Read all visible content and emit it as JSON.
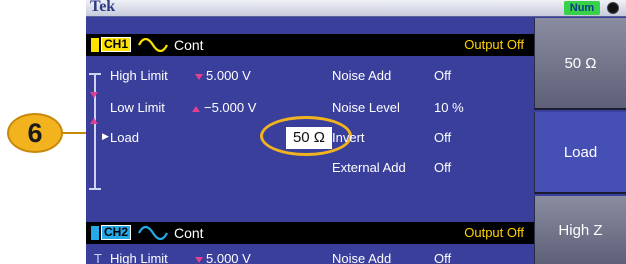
{
  "callout": {
    "number": "6"
  },
  "top_bar": {
    "brand": "Tek",
    "num_badge": "Num"
  },
  "ch1": {
    "label": "CH1",
    "mode": "Cont",
    "output_status": "Output Off",
    "high_limit_label": "High Limit",
    "high_limit_value": "5.000 V",
    "low_limit_label": "Low Limit",
    "low_limit_value": "−5.000 V",
    "load_label": "Load",
    "load_value": "50 Ω",
    "noise_add_label": "Noise Add",
    "noise_add_value": "Off",
    "noise_level_label": "Noise Level",
    "noise_level_value": "10 %",
    "invert_label": "Invert",
    "invert_value": "Off",
    "external_add_label": "External Add",
    "external_add_value": "Off"
  },
  "ch2": {
    "label": "CH2",
    "mode": "Cont",
    "output_status": "Output Off",
    "high_limit_label": "High Limit",
    "high_limit_value": "5.000 V",
    "noise_add_label": "Noise Add",
    "noise_add_value": "Off"
  },
  "side_menu": {
    "items": [
      {
        "label": "50 Ω"
      },
      {
        "label": "Load"
      },
      {
        "label": "High Z"
      }
    ]
  },
  "colors": {
    "screen_bg": "#3a3f9c",
    "ch1_color": "#ffe100",
    "ch2_color": "#25a9e8",
    "output_off": "#ffd200",
    "callout": "#f2b31e",
    "menu_bg": "#6f7287",
    "menu_selected_bg": "#4650b4"
  }
}
